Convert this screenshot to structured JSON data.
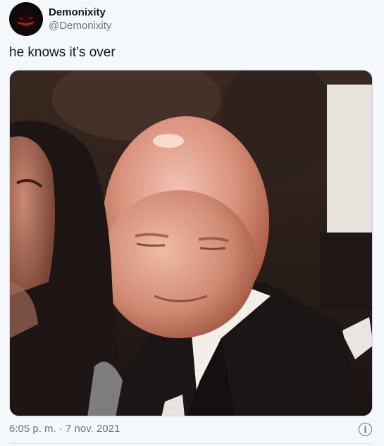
{
  "author": {
    "display_name": "Demonixity",
    "handle": "@Demonixity",
    "avatar_icon": "demon-smile-avatar"
  },
  "tweet": {
    "text": "he knows it’s over",
    "time": "6:05 p. m.",
    "separator": "·",
    "date": "7 nov. 2021"
  },
  "media": {
    "alt": "photo"
  },
  "colors": {
    "text_primary": "#14171a",
    "text_secondary": "#657786",
    "background": "#f5f8fa",
    "border": "#ccd6dd"
  },
  "icons": {
    "info": "info-icon"
  }
}
